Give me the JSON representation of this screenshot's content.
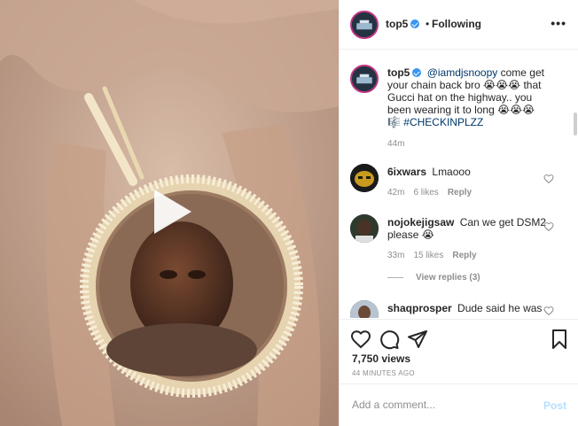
{
  "post": {
    "username": "top5",
    "follow_status": "Following",
    "separator": "•",
    "more_icon": "more-horizontal-icon",
    "caption": {
      "username": "top5",
      "mention": "@iamdjsnoopy",
      "text_1": "come get your chain back bro 😭😭😭 that Gucci hat on the highway.. you been wearing it to long 😭😭😭 🎼",
      "hashtag": "#CHECKINPLZZ",
      "time": "44m"
    },
    "views": "7,750 views",
    "time_ago": "44 MINUTES AGO"
  },
  "comments": [
    {
      "username": "6ixwars",
      "text": "Lmaooo",
      "time": "42m",
      "likes": "6 likes",
      "reply": "Reply"
    },
    {
      "username": "nojokejigsaw",
      "text": "Can we get DSM2 please 😭",
      "time": "33m",
      "likes": "15 likes",
      "reply": "Reply",
      "view_replies": "View replies (3)"
    },
    {
      "username": "shaqprosper",
      "text": "Dude said he was"
    }
  ],
  "add_comment": {
    "placeholder": "Add a comment...",
    "post_label": "Post"
  },
  "colors": {
    "link": "#00376b",
    "verified": "#3897f0",
    "post_disabled": "#b2dffc",
    "muted": "#8e8e8e"
  }
}
